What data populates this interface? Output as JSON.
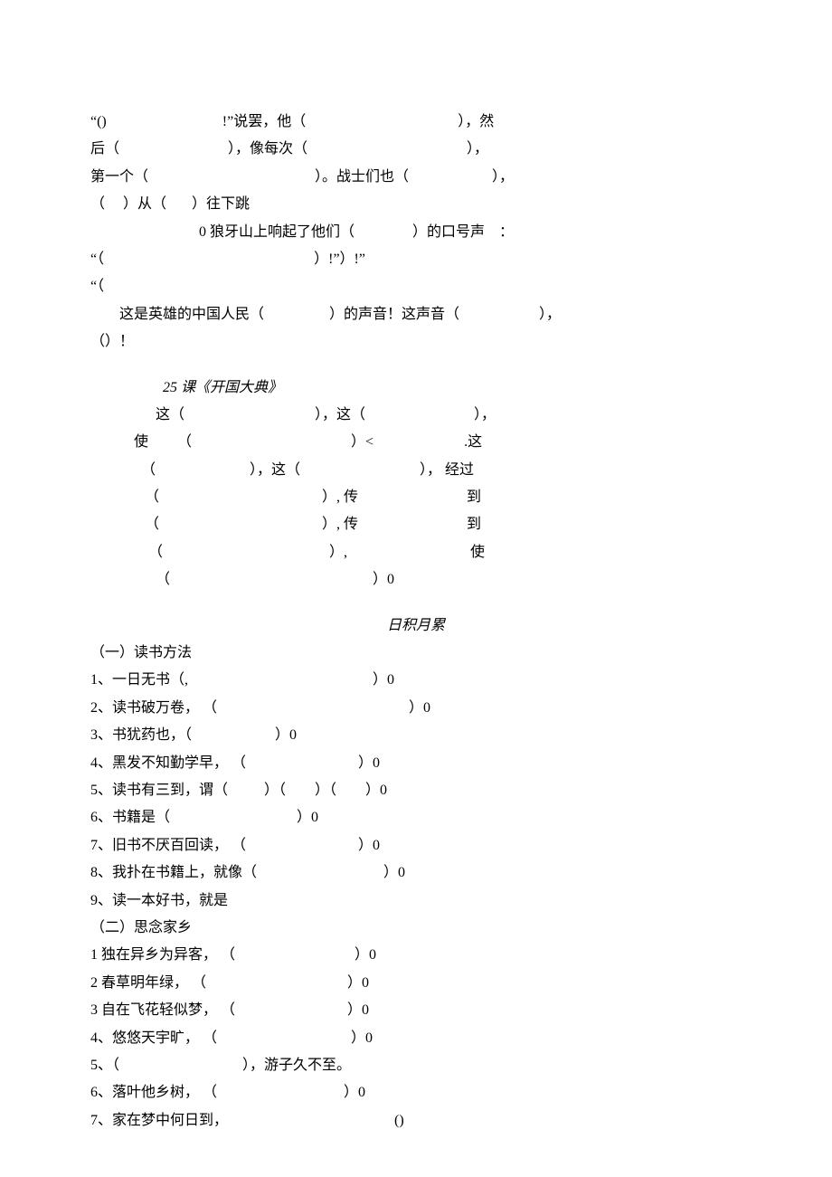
{
  "p1": {
    "l1a": "“()",
    "l1b": "!”说罢，他（",
    "l1c": "），然",
    "l2a": "后（",
    "l2b": "），像每次（",
    "l2c": "），",
    "l3a": "第一个（",
    "l3b": "）。战士们也（",
    "l3c": "），",
    "l4a": "（     ）从（       ）往下跳",
    "l5a": "0 狼牙山上响起了他们（",
    "l5b": "）的口号声",
    "l5c": "：",
    "l6a": "“（",
    "l6b": "）!”）!”",
    "l7a": "“（",
    "l8a": "这是英雄的中国人民（",
    "l8b": "）的声音！这声音（",
    "l8c": "），",
    "l9a": "（）！"
  },
  "course": {
    "title": "25 课《开国大典》",
    "l1a": "这（",
    "l1b": "），这（",
    "l1c": "），",
    "l2a": "使",
    "l2b": "（",
    "l2c": "）<",
    "l2d": ".这",
    "l3a": "（",
    "l3b": "），这（",
    "l3c": "）， 经过",
    "l4a": "（",
    "l4b": "）, 传",
    "l4c": "到",
    "l5a": "（",
    "l5b": "）, 传",
    "l5c": "到",
    "l6a": "（",
    "l6b": "）,",
    "l6c": "使",
    "l7a": "（",
    "l7b": "）0"
  },
  "rj": {
    "title": "日积月累",
    "s1": {
      "head": "（一）读书方法",
      "i1a": "1、一日无书（,",
      "i1b": "）0",
      "i2a": "2、读书破万卷， （",
      "i2b": "）0",
      "i3a": "3、书犹药也，（",
      "i3b": "）0",
      "i4a": "4、黑发不知勤学早， （",
      "i4b": "）0",
      "i5a": "5、读书有三到，谓（",
      "i5b": "）（        ）（        ）0",
      "i6a": "6、书籍是（",
      "i6b": "）0",
      "i7a": "7、旧书不厌百回读， （",
      "i7b": "）0",
      "i8a": "8、我扑在书籍上，就像（",
      "i8b": "）0",
      "i9a": "9、读一本好书，就是"
    },
    "s2": {
      "head": "（二）思念家乡",
      "i1a": "1 独在异乡为异客， （",
      "i1b": "）0",
      "i2a": "2 春草明年绿， （",
      "i2b": "）0",
      "i3a": "3 自在飞花轻似梦， （",
      "i3b": "）0",
      "i4a": "4、悠悠天宇旷， （",
      "i4b": "）0",
      "i5a": "5、（",
      "i5b": "），游子久不至。",
      "i6a": "6、落叶他乡树， （",
      "i6b": "）0",
      "i7a": "7、家在梦中何日到，",
      "i7b": "()"
    }
  }
}
